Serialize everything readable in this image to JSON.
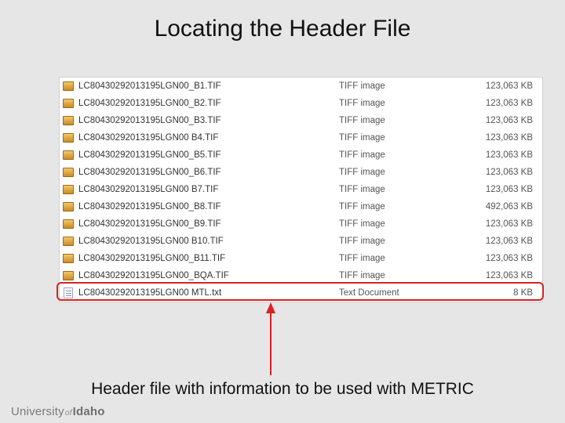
{
  "title": "Locating the Header File",
  "caption": "Header file with information to be used with METRIC",
  "brand": {
    "part1": "University",
    "of": "of",
    "part2": "Idaho"
  },
  "file_prefix": "LC80430292013195LGN00",
  "files": [
    {
      "name": "LC80430292013195LGN00_B1.TIF",
      "type": "TIFF image",
      "size": "123,063 KB",
      "icon": "tif"
    },
    {
      "name": "LC80430292013195LGN00_B2.TIF",
      "type": "TIFF image",
      "size": "123,063 KB",
      "icon": "tif"
    },
    {
      "name": "LC80430292013195LGN00_B3.TIF",
      "type": "TIFF image",
      "size": "123,063 KB",
      "icon": "tif"
    },
    {
      "name": "LC80430292013195LGN00 B4.TIF",
      "type": "TIFF image",
      "size": "123,063 KB",
      "icon": "tif"
    },
    {
      "name": "LC80430292013195LGN00_B5.TIF",
      "type": "TIFF image",
      "size": "123,063 KB",
      "icon": "tif"
    },
    {
      "name": "LC80430292013195LGN00_B6.TIF",
      "type": "TIFF image",
      "size": "123,063 KB",
      "icon": "tif"
    },
    {
      "name": "LC80430292013195LGN00 B7.TIF",
      "type": "TIFF image",
      "size": "123,063 KB",
      "icon": "tif"
    },
    {
      "name": "LC80430292013195LGN00_B8.TIF",
      "type": "TIFF image",
      "size": "492,063 KB",
      "icon": "tif"
    },
    {
      "name": "LC80430292013195LGN00_B9.TIF",
      "type": "TIFF image",
      "size": "123,063 KB",
      "icon": "tif"
    },
    {
      "name": "LC80430292013195LGN00 B10.TIF",
      "type": "TIFF image",
      "size": "123,063 KB",
      "icon": "tif"
    },
    {
      "name": "LC80430292013195LGN00_B11.TIF",
      "type": "TIFF image",
      "size": "123,063 KB",
      "icon": "tif"
    },
    {
      "name": "LC80430292013195LGN00_BQA.TIF",
      "type": "TIFF image",
      "size": "123,063 KB",
      "icon": "tif"
    },
    {
      "name": "LC80430292013195LGN00 MTL.txt",
      "type": "Text Document",
      "size": "8 KB",
      "icon": "txt"
    }
  ],
  "highlight_index": 12,
  "colors": {
    "highlight": "#d62222",
    "arrow": "#d62222"
  }
}
